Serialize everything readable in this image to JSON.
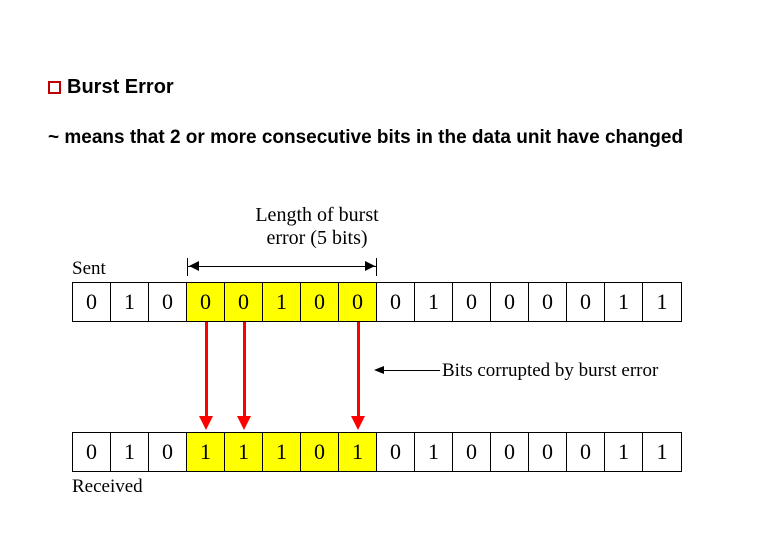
{
  "title": "Burst Error",
  "definition": "~ means that 2 or more consecutive bits in the data unit have changed",
  "length_label_line1": "Length of burst",
  "length_label_line2": "error (5 bits)",
  "sent_label": "Sent",
  "received_label": "Received",
  "corrupt_label": "Bits corrupted by burst error",
  "sent_bits": [
    "0",
    "1",
    "0",
    "0",
    "0",
    "1",
    "0",
    "0",
    "0",
    "1",
    "0",
    "0",
    "0",
    "0",
    "1",
    "1"
  ],
  "recv_bits": [
    "0",
    "1",
    "0",
    "1",
    "1",
    "1",
    "0",
    "1",
    "0",
    "1",
    "0",
    "0",
    "0",
    "0",
    "1",
    "1"
  ],
  "changed_index": [
    3,
    4,
    7
  ],
  "burst_span": [
    3,
    7
  ],
  "chart_data": {
    "type": "table",
    "title": "Burst error example: 5-bit burst span corrupts bits at indices 3,4,7",
    "series": [
      {
        "name": "Sent",
        "values": [
          0,
          1,
          0,
          0,
          0,
          1,
          0,
          0,
          0,
          1,
          0,
          0,
          0,
          0,
          1,
          1
        ]
      },
      {
        "name": "Received",
        "values": [
          0,
          1,
          0,
          1,
          1,
          1,
          0,
          1,
          0,
          1,
          0,
          0,
          0,
          0,
          1,
          1
        ]
      }
    ],
    "burst_start_index": 3,
    "burst_end_index": 7,
    "burst_length_bits": 5,
    "bits_flipped_indices": [
      3,
      4,
      7
    ]
  }
}
